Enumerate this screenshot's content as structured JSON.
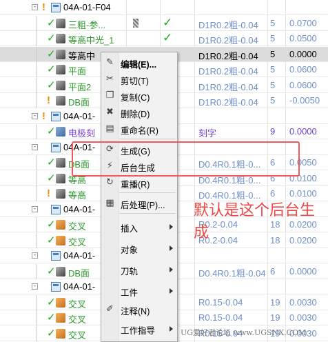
{
  "tree": {
    "rows": [
      {
        "kind": "group",
        "name": "04A-01-F04",
        "warn": true,
        "expander": "-",
        "col_method": "",
        "col_stock": "",
        "col_tol": ""
      },
      {
        "kind": "op",
        "name": "三粗-参...",
        "check": true,
        "toolbox": true,
        "bigcheck": true,
        "col_method": "D1R0.2粗-0.04",
        "col_stock": "5",
        "col_tol": "0.0700"
      },
      {
        "kind": "op",
        "name": "等高中光_1",
        "check": true,
        "bigcheck": true,
        "col_method": "D1R0.2粗-0.04",
        "col_stock": "5",
        "col_tol": "0.0500"
      },
      {
        "kind": "op",
        "name": "等高中",
        "check": true,
        "selected": true,
        "col_method": "D1R0.2粗-0.04",
        "col_stock": "5",
        "col_tol": "0.0000"
      },
      {
        "kind": "op",
        "name": "平面",
        "check": true,
        "col_method": "D1R0.2粗-0.04",
        "col_stock": "5",
        "col_tol": "0.0600"
      },
      {
        "kind": "op",
        "name": "平面2",
        "check": true,
        "col_method": "D1R0.2粗-0.04",
        "col_stock": "5",
        "col_tol": "0.0600"
      },
      {
        "kind": "op",
        "name": "DB面",
        "warn": true,
        "col_method": "D1R0.2粗-0.04",
        "col_stock": "5",
        "col_tol": "-0.0050"
      },
      {
        "kind": "group",
        "name": "04A-01-",
        "warn": true,
        "expander": "-",
        "col_method": "",
        "col_stock": "",
        "col_tol": ""
      },
      {
        "kind": "op",
        "name": "电极刻",
        "check": true,
        "purple": true,
        "col_method": "刻字",
        "col_stock": "9",
        "col_tol": "0.0000"
      },
      {
        "kind": "group",
        "name": "04A-01-",
        "warn": false,
        "expander": "-",
        "col_method": "",
        "col_stock": "",
        "col_tol": ""
      },
      {
        "kind": "op",
        "name": "DB面",
        "check": true,
        "col_method": "D0.4R0.1粗-0...",
        "col_stock": "6",
        "col_tol": "0.0050"
      },
      {
        "kind": "op",
        "name": "等高",
        "check": true,
        "col_method": "D0.4R0.1粗-0...",
        "col_stock": "6",
        "col_tol": "0.0100"
      },
      {
        "kind": "op",
        "name": "等高",
        "warn": true,
        "col_method": "D0.4R0.1粗-0...",
        "col_stock": "6",
        "col_tol": "0.0100"
      },
      {
        "kind": "group",
        "name": "04A-01-",
        "warn": false,
        "expander": "-",
        "col_method": "",
        "col_stock": "",
        "col_tol": ""
      },
      {
        "kind": "op",
        "name": "交叉",
        "check": true,
        "col_method": "R0.2-0.04",
        "col_stock": "18",
        "col_tol": "0.0200"
      },
      {
        "kind": "op",
        "name": "交叉",
        "check": true,
        "col_method": "R0.2-0.04",
        "col_stock": "18",
        "col_tol": "0.0200"
      },
      {
        "kind": "group",
        "name": "04A-01-",
        "warn": false,
        "expander": "-",
        "col_method": "",
        "col_stock": "",
        "col_tol": ""
      },
      {
        "kind": "op",
        "name": "DB面",
        "check": true,
        "col_method": "D0.4R0.1粗-0.04",
        "col_stock": "6",
        "col_tol": "0.0000"
      },
      {
        "kind": "group",
        "name": "04A-01-",
        "warn": false,
        "expander": "-",
        "col_method": "",
        "col_stock": "",
        "col_tol": ""
      },
      {
        "kind": "op",
        "name": "交叉",
        "check": true,
        "col_method": "R0.15-0.04",
        "col_stock": "19",
        "col_tol": "0.0030"
      },
      {
        "kind": "op",
        "name": "交叉",
        "check": true,
        "col_method": "R0.15-0.04",
        "col_stock": "19",
        "col_tol": "0.0030"
      },
      {
        "kind": "op",
        "name": "交叉",
        "check": true,
        "col_method": "R0.15-0.04",
        "col_stock": "19",
        "col_tol": "0.0030"
      }
    ]
  },
  "context_menu": {
    "items": [
      {
        "label": "编辑(E)...",
        "icon": "edit-icon",
        "glyph": "✎",
        "bold": true
      },
      {
        "label": "剪切(T)",
        "icon": "cut-icon",
        "glyph": "✂"
      },
      {
        "label": "复制(C)",
        "icon": "copy-icon",
        "glyph": "❐"
      },
      {
        "label": "删除(D)",
        "icon": "delete-icon",
        "glyph": "✖"
      },
      {
        "label": "重命名(R)",
        "icon": "rename-icon",
        "glyph": "▤"
      },
      {
        "sep": true
      },
      {
        "label": "生成(G)",
        "icon": "generate-icon",
        "glyph": "⟳"
      },
      {
        "label": "后台生成",
        "icon": "background-generate-icon",
        "glyph": "⚡"
      },
      {
        "label": "重播(R)",
        "icon": "replay-icon",
        "glyph": "↻"
      },
      {
        "sep": true
      },
      {
        "label": "后处理(P)...",
        "icon": "postprocess-icon",
        "glyph": "▦"
      },
      {
        "sep": true
      },
      {
        "label": "插入",
        "icon": "",
        "glyph": "",
        "submenu": true
      },
      {
        "label": "对象",
        "icon": "",
        "glyph": "",
        "submenu": true
      },
      {
        "label": "刀轨",
        "icon": "",
        "glyph": "",
        "submenu": true
      },
      {
        "label": "工件",
        "icon": "",
        "glyph": "",
        "submenu": true
      },
      {
        "label": "注释(N)",
        "icon": "annotation-icon",
        "glyph": "✐"
      },
      {
        "label": "工作指导",
        "icon": "",
        "glyph": "",
        "submenu": true
      }
    ]
  },
  "annotation": {
    "callout_text": "默认是这个后台生成",
    "highlight_color": "#ee5a5a"
  },
  "watermark": "UG爱好者论坛 www.UGSNX.COM",
  "colors": {
    "check_green": "#22a822",
    "warn_orange": "#f08a00",
    "dim_blue": "#6f8ec8"
  }
}
